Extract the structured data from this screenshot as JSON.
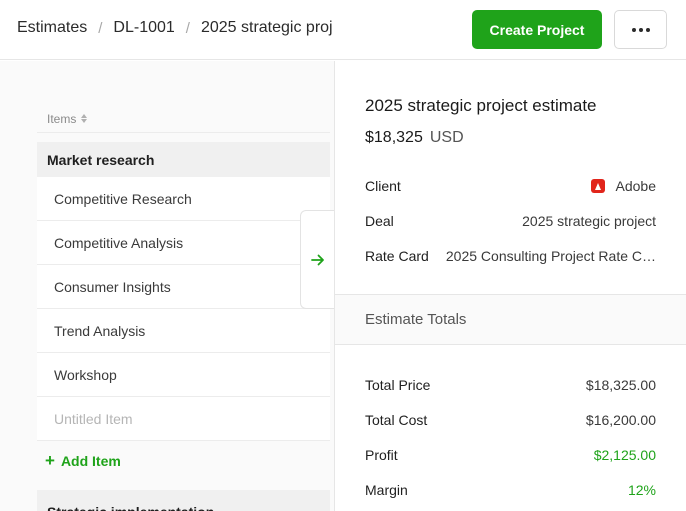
{
  "breadcrumb": [
    "Estimates",
    "DL-1001",
    "2025 strategic proj"
  ],
  "header": {
    "create_label": "Create Project",
    "more_icon": "more-horizontal-icon"
  },
  "items": {
    "header_label": "Items",
    "group1": "Market research",
    "rows": [
      "Competitive Research",
      "Competitive Analysis",
      "Consumer Insights",
      "Trend Analysis",
      "Workshop"
    ],
    "placeholder": "Untitled Item",
    "add_label": "Add Item",
    "group2": "Strategic implementation"
  },
  "estimate": {
    "title": "2025 strategic project estimate",
    "amount": "$18,325",
    "currency": "USD",
    "client_label": "Client",
    "client_value": "Adobe",
    "deal_label": "Deal",
    "deal_value": "2025 strategic project",
    "rate_label": "Rate Card",
    "rate_value": "2025 Consulting Project Rate C…"
  },
  "totals": {
    "heading": "Estimate Totals",
    "rows": [
      {
        "label": "Total Price",
        "value": "$18,325.00"
      },
      {
        "label": "Total Cost",
        "value": "$16,200.00"
      },
      {
        "label": "Profit",
        "value": "$2,125.00"
      },
      {
        "label": "Margin",
        "value": "12%"
      }
    ]
  },
  "colors": {
    "accent": "#1fa31a",
    "client_logo": "#e1251b"
  }
}
